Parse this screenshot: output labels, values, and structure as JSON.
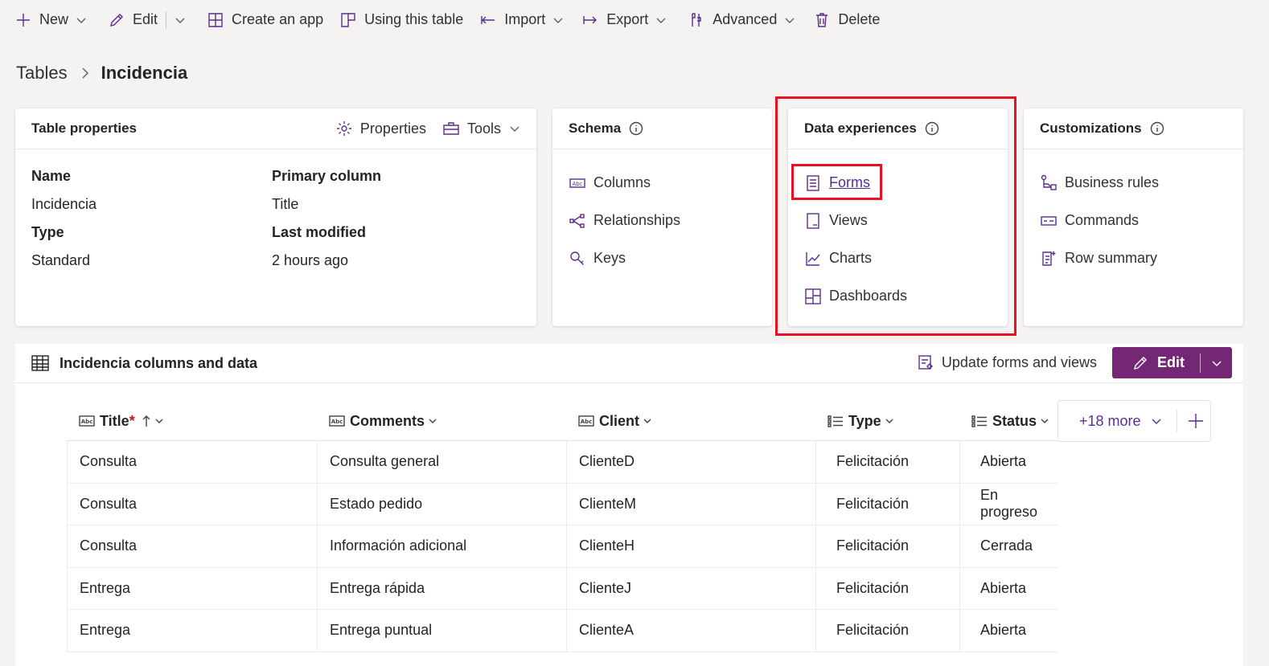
{
  "commandbar": {
    "new": "New",
    "edit": "Edit",
    "create_app": "Create an app",
    "using_table": "Using this table",
    "import": "Import",
    "export": "Export",
    "advanced": "Advanced",
    "delete": "Delete"
  },
  "breadcrumb": {
    "parent": "Tables",
    "current": "Incidencia"
  },
  "table_properties": {
    "title": "Table properties",
    "properties_label": "Properties",
    "tools_label": "Tools",
    "name_label": "Name",
    "name_value": "Incidencia",
    "primary_label": "Primary column",
    "primary_value": "Title",
    "type_label": "Type",
    "type_value": "Standard",
    "modified_label": "Last modified",
    "modified_value": "2 hours ago"
  },
  "schema": {
    "title": "Schema",
    "items": [
      "Columns",
      "Relationships",
      "Keys"
    ]
  },
  "data_experiences": {
    "title": "Data experiences",
    "items": [
      "Forms",
      "Views",
      "Charts",
      "Dashboards"
    ]
  },
  "customizations": {
    "title": "Customizations",
    "items": [
      "Business rules",
      "Commands",
      "Row summary"
    ]
  },
  "data_section": {
    "title": "Incidencia columns and data",
    "update_label": "Update forms and views",
    "edit_label": "Edit",
    "more_label": "+18 more",
    "columns": [
      {
        "label": "Title",
        "required": "*"
      },
      {
        "label": "Comments"
      },
      {
        "label": "Client"
      },
      {
        "label": "Type"
      },
      {
        "label": "Status"
      }
    ],
    "rows": [
      [
        "Consulta",
        "Consulta general",
        "ClienteD",
        "Felicitación",
        "Abierta"
      ],
      [
        "Consulta",
        "Estado pedido",
        "ClienteM",
        "Felicitación",
        "En progreso"
      ],
      [
        "Consulta",
        "Información adicional",
        "ClienteH",
        "Felicitación",
        "Cerrada"
      ],
      [
        "Entrega",
        "Entrega rápida",
        "ClienteJ",
        "Felicitación",
        "Abierta"
      ],
      [
        "Entrega",
        "Entrega puntual",
        "ClienteA",
        "Felicitación",
        "Abierta"
      ]
    ]
  },
  "colors": {
    "accent": "#742774",
    "icon": "#5c2d91",
    "highlight": "#e81123"
  }
}
